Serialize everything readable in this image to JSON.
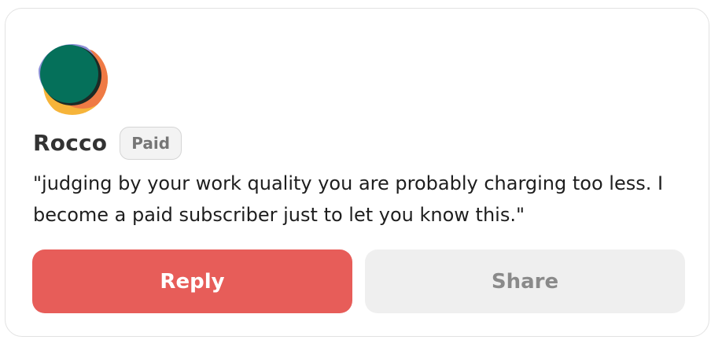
{
  "comment_card": {
    "author": {
      "name": "Rocco",
      "badge": "Paid",
      "avatar_icon": "abstract-avatar-icon"
    },
    "text": "\"judging by your work quality you are probably charging too less. I become a paid subscriber just to let you know this.\"",
    "actions": {
      "reply_label": "Reply",
      "share_label": "Share"
    },
    "colors": {
      "reply_bg": "#e75d59",
      "share_bg": "#efefef",
      "avatar_primary": "#05705a",
      "avatar_secondary": "#f4a236",
      "avatar_accent": "#8b8fd6"
    }
  }
}
